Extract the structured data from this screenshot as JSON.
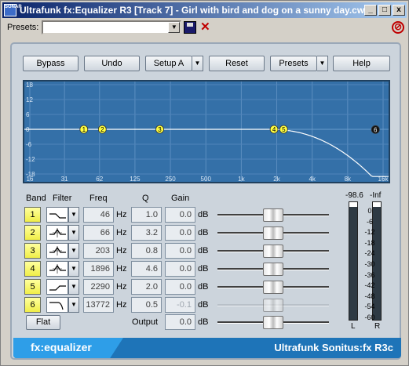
{
  "window": {
    "title": "Ultrafunk fx:Equalizer R3 [Track 7] - Girl with bird and dog on a sunny day.cwp",
    "app_icon_text": "SONAR",
    "minimize": "_",
    "maximize": "□",
    "close": "x"
  },
  "presets_bar": {
    "label": "Presets:",
    "value": "",
    "dropdown_arrow": "▼",
    "save_icon": "save-icon",
    "delete_icon": "delete-icon",
    "bypass_icon": "no-entry-icon"
  },
  "toolbar": {
    "bypass": "Bypass",
    "undo": "Undo",
    "setup": "Setup A",
    "reset": "Reset",
    "presets": "Presets",
    "help": "Help",
    "dropdown_arrow": "▼"
  },
  "graph": {
    "y_ticks": [
      "18",
      "12",
      "6",
      "0",
      "-6",
      "-12",
      "-18"
    ],
    "x_ticks": [
      "16",
      "31",
      "62",
      "125",
      "250",
      "500",
      "1k",
      "2k",
      "4k",
      "8k",
      "16k"
    ],
    "markers": [
      {
        "label": "1",
        "freq": 46,
        "gain": 0.0
      },
      {
        "label": "2",
        "freq": 66,
        "gain": 0.0
      },
      {
        "label": "3",
        "freq": 203,
        "gain": 0.0
      },
      {
        "label": "4",
        "freq": 1896,
        "gain": 0.0
      },
      {
        "label": "5",
        "freq": 2290,
        "gain": 0.0
      },
      {
        "label": "6",
        "freq": 13772,
        "gain": -0.1
      }
    ],
    "curve_color": "#ffffff",
    "background_color": "#3470a8"
  },
  "headers": {
    "band": "Band",
    "filter": "Filter",
    "freq": "Freq",
    "q": "Q",
    "gain": "Gain"
  },
  "bands": [
    {
      "band": "1",
      "filter_icon": "low-shelf-icon",
      "freq": "46",
      "freq_unit": "Hz",
      "q": "1.0",
      "gain": "0.0",
      "gain_unit": "dB",
      "gain_level": 0.5,
      "enabled": true
    },
    {
      "band": "2",
      "filter_icon": "peak-icon",
      "freq": "66",
      "freq_unit": "Hz",
      "q": "3.2",
      "gain": "0.0",
      "gain_unit": "dB",
      "gain_level": 0.5,
      "enabled": true
    },
    {
      "band": "3",
      "filter_icon": "peak-icon",
      "freq": "203",
      "freq_unit": "Hz",
      "q": "0.8",
      "gain": "0.0",
      "gain_unit": "dB",
      "gain_level": 0.5,
      "enabled": true
    },
    {
      "band": "4",
      "filter_icon": "peak-icon",
      "freq": "1896",
      "freq_unit": "Hz",
      "q": "4.6",
      "gain": "0.0",
      "gain_unit": "dB",
      "gain_level": 0.5,
      "enabled": true
    },
    {
      "band": "5",
      "filter_icon": "high-shelf-icon",
      "freq": "2290",
      "freq_unit": "Hz",
      "q": "2.0",
      "gain": "0.0",
      "gain_unit": "dB",
      "gain_level": 0.5,
      "enabled": true
    },
    {
      "band": "6",
      "filter_icon": "low-pass-icon",
      "freq": "13772",
      "freq_unit": "Hz",
      "q": "0.5",
      "gain": "-0.1",
      "gain_unit": "dB",
      "gain_level": 0.5,
      "enabled": false
    }
  ],
  "flat_button": "Flat",
  "output": {
    "label": "Output",
    "value": "0.0",
    "unit": "dB",
    "level": 0.5
  },
  "meters": {
    "left_peak": "-98.6",
    "right_peak": "-Inf",
    "scale": [
      "0",
      "-6",
      "-12",
      "-18",
      "-24",
      "-30",
      "-36",
      "-42",
      "-48",
      "-54",
      "-60"
    ],
    "left_label": "L",
    "right_label": "R"
  },
  "footer": {
    "brand": "fx:equalizer",
    "product": "Ultrafunk Sonitus:fx R3c"
  }
}
